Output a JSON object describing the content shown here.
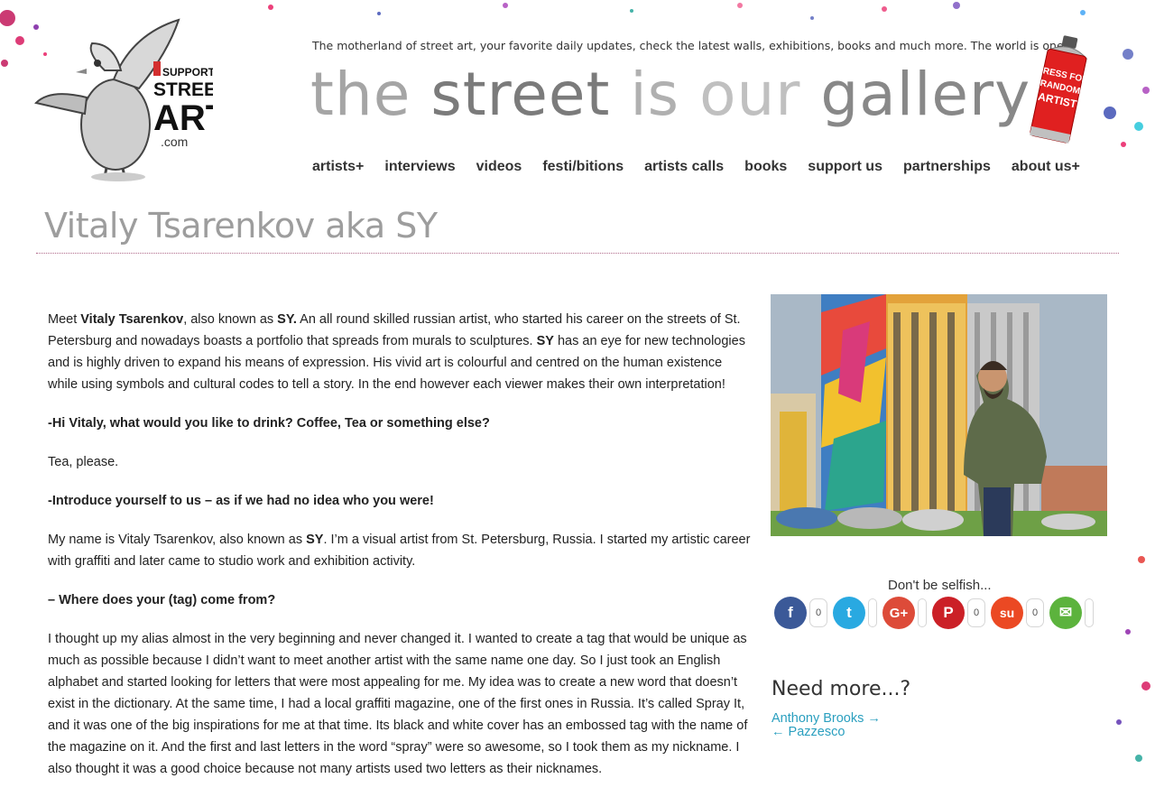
{
  "header": {
    "tagline": "The motherland of street art, your favorite daily updates, check the latest walls, exhibitions, books and much more. The world is one.",
    "headline_words": [
      "the",
      "street",
      "is",
      "our",
      "gallery"
    ],
    "logo_text": {
      "support": "SUPPORT",
      "street": "STREET",
      "art": "ART",
      "dotcom": ".com"
    },
    "spraycan_text": "PRESS FOR RANDOM ARTIST"
  },
  "nav": {
    "items": [
      "artists+",
      "interviews",
      "videos",
      "festi/bitions",
      "artists calls",
      "books",
      "support us",
      "partnerships",
      "about us+"
    ]
  },
  "page": {
    "title": "Vitaly Tsarenkov aka SY"
  },
  "article": {
    "p1_a": "Meet ",
    "p1_b": "Vitaly Tsarenkov",
    "p1_c": ", also known as ",
    "p1_d": "SY.",
    "p1_e": " An all round skilled russian artist, who started his career on the streets of St. Petersburg and nowadays boasts a portfolio that spreads from murals to sculptures. ",
    "p1_f": "SY",
    "p1_g": " has an eye for new technologies and is highly driven to expand his means of expression. His vivid art is colourful and centred on the human existence while using symbols and cultural codes to tell a story. In the end however each viewer makes their own interpretation!",
    "q1": "-Hi Vitaly, what would you like to drink? Coffee, Tea or something else?",
    "a1": "Tea, please.",
    "q2": "-Introduce yourself to us – as if we had no idea who you were!",
    "a2_a": "My name is Vitaly Tsarenkov, also known as ",
    "a2_b": "SY",
    "a2_c": ". I’m a visual artist from St. Petersburg, Russia. I started my artistic career with graffiti and later came to studio work and exhibition activity.",
    "q3": "– Where does your (tag) come from?",
    "a3": "I thought up my alias almost in the very beginning and never changed it. I wanted to create a tag that would be unique as much as possible because I didn’t want to meet another artist with the same name one day. So I just took an English alphabet and started looking for letters that were most appealing for me. My idea was to create a new word that doesn’t exist in the dictionary. At the same time, I had a local graffiti magazine, one of the first ones in Russia. It’s called Spray It, and it was one of the big inspirations for me at that time. Its black and white cover has an embossed tag with the name of the magazine on it. And the first and last letters in the word “spray” were so awesome, so I took them as my nickname. I also thought it was a good choice because not many artists used two letters as their nicknames."
  },
  "share": {
    "label": "Don't be selfish...",
    "buttons": [
      {
        "name": "facebook",
        "glyph": "f",
        "color": "#3b5998",
        "count": "0"
      },
      {
        "name": "twitter",
        "glyph": "t",
        "color": "#29a9e1",
        "count": ""
      },
      {
        "name": "google-plus",
        "glyph": "G+",
        "color": "#dd4b39",
        "count": ""
      },
      {
        "name": "pinterest",
        "glyph": "P",
        "color": "#cb2027",
        "count": "0"
      },
      {
        "name": "stumbleupon",
        "glyph": "su",
        "color": "#eb4923",
        "count": "0"
      },
      {
        "name": "email",
        "glyph": "✉",
        "color": "#5cb33d",
        "count": ""
      }
    ]
  },
  "more": {
    "title": "Need more...?",
    "next": "Anthony Brooks →",
    "prev": "← Pazzesco"
  }
}
